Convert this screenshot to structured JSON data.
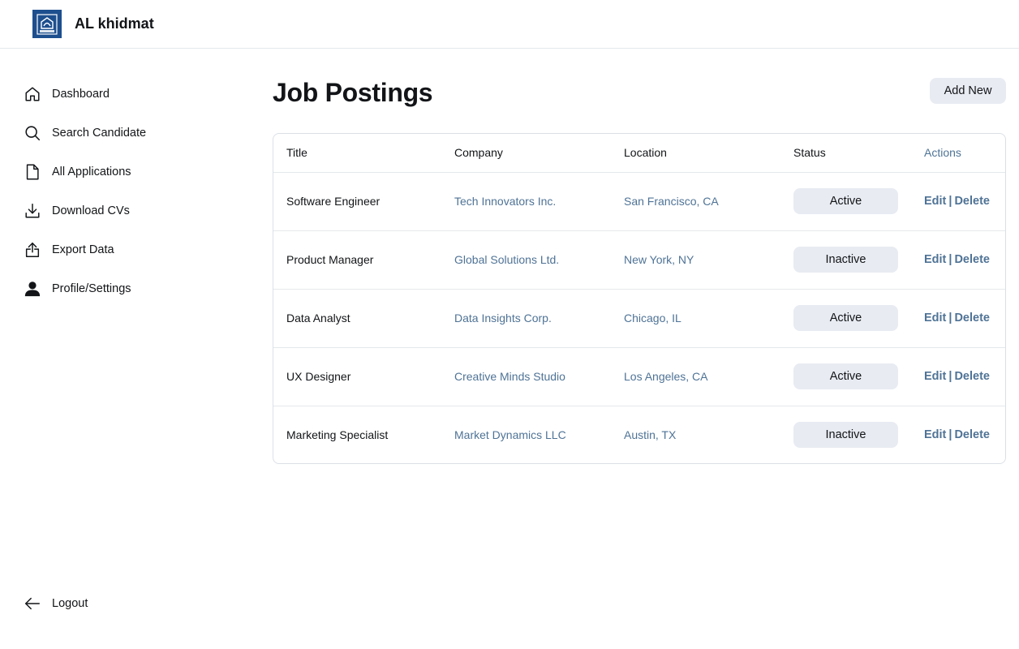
{
  "app": {
    "name": "AL khidmat",
    "logo_text": "ALKHIDMAT",
    "brand_color": "#1d4f8e"
  },
  "sidebar": {
    "items": [
      {
        "label": "Dashboard",
        "icon": "home-icon"
      },
      {
        "label": "Search Candidate",
        "icon": "search-icon"
      },
      {
        "label": "All Applications",
        "icon": "file-icon"
      },
      {
        "label": "Download CVs",
        "icon": "download-icon"
      },
      {
        "label": "Export Data",
        "icon": "export-icon"
      },
      {
        "label": "Profile/Settings",
        "icon": "user-icon"
      }
    ],
    "logout": {
      "label": "Logout",
      "icon": "arrow-left-icon"
    }
  },
  "main": {
    "title": "Job Postings",
    "add_button": "Add New",
    "table": {
      "headers": [
        "Title",
        "Company",
        "Location",
        "Status",
        "Actions"
      ],
      "rows": [
        {
          "title": "Software Engineer",
          "company": "Tech Innovators Inc.",
          "location": "San Francisco, CA",
          "status": "Active",
          "edit": "Edit",
          "sep": "|",
          "delete": "Delete"
        },
        {
          "title": "Product Manager",
          "company": "Global Solutions Ltd.",
          "location": "New York, NY",
          "status": "Inactive",
          "edit": "Edit",
          "sep": "|",
          "delete": "Delete"
        },
        {
          "title": "Data Analyst",
          "company": "Data Insights Corp.",
          "location": "Chicago, IL",
          "status": "Active",
          "edit": "Edit",
          "sep": "|",
          "delete": "Delete"
        },
        {
          "title": "UX Designer",
          "company": "Creative Minds Studio",
          "location": "Los Angeles, CA",
          "status": "Active",
          "edit": "Edit",
          "sep": "|",
          "delete": "Delete"
        },
        {
          "title": "Marketing Specialist",
          "company": "Market Dynamics LLC",
          "location": "Austin, TX",
          "status": "Inactive",
          "edit": "Edit",
          "sep": "|",
          "delete": "Delete"
        }
      ]
    }
  },
  "colors": {
    "accent_text": "#4f7396",
    "chip_bg": "#e8ebf2",
    "border": "#dbe0e6"
  }
}
